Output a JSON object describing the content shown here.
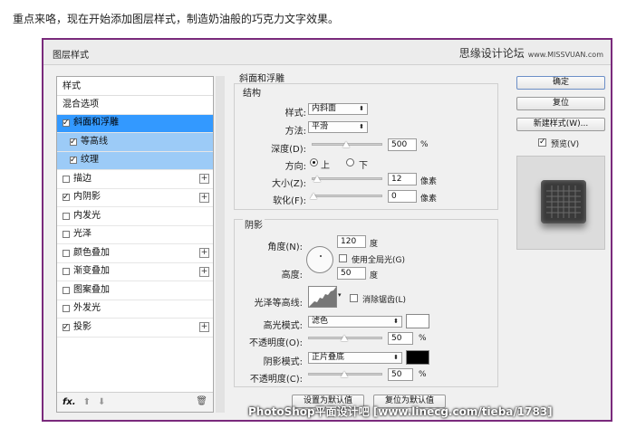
{
  "intro": "重点来咯，现在开始添加图层样式，制造奶油般的巧克力文字效果。",
  "dialog": {
    "title": "图层样式",
    "brand": "思缘设计论坛",
    "brand_url": "www.MISSVUAN.com"
  },
  "stylelist": {
    "header": "样式",
    "items": [
      {
        "label": "混合选项",
        "checkbox": false,
        "checked": false,
        "plus": false
      },
      {
        "label": "斜面和浮雕",
        "checkbox": true,
        "checked": true,
        "plus": false,
        "selected": true
      },
      {
        "label": "等高线",
        "checkbox": true,
        "checked": true,
        "plus": false,
        "sub": true
      },
      {
        "label": "纹理",
        "checkbox": true,
        "checked": true,
        "plus": false,
        "sub": true
      },
      {
        "label": "描边",
        "checkbox": true,
        "checked": false,
        "plus": true
      },
      {
        "label": "内阴影",
        "checkbox": true,
        "checked": true,
        "plus": true
      },
      {
        "label": "内发光",
        "checkbox": true,
        "checked": false,
        "plus": false
      },
      {
        "label": "光泽",
        "checkbox": true,
        "checked": false,
        "plus": false
      },
      {
        "label": "颜色叠加",
        "checkbox": true,
        "checked": false,
        "plus": true
      },
      {
        "label": "渐变叠加",
        "checkbox": true,
        "checked": false,
        "plus": true
      },
      {
        "label": "图案叠加",
        "checkbox": true,
        "checked": false,
        "plus": false
      },
      {
        "label": "外发光",
        "checkbox": true,
        "checked": false,
        "plus": false
      },
      {
        "label": "投影",
        "checkbox": true,
        "checked": true,
        "plus": true
      }
    ],
    "footer_fx": "fx."
  },
  "bevel": {
    "section_title": "斜面和浮雕",
    "structure_title": "结构",
    "style_label": "样式:",
    "style_value": "内斜面",
    "technique_label": "方法:",
    "technique_value": "平滑",
    "depth_label": "深度(D):",
    "depth_value": "500",
    "depth_unit": "%",
    "direction_label": "方向:",
    "direction_up": "上",
    "direction_down": "下",
    "size_label": "大小(Z):",
    "size_value": "12",
    "size_unit": "像素",
    "soften_label": "软化(F):",
    "soften_value": "0",
    "soften_unit": "像素"
  },
  "shading": {
    "title": "阴影",
    "angle_label": "角度(N):",
    "angle_value": "120",
    "angle_unit": "度",
    "global_light_label": "使用全局光(G)",
    "altitude_label": "高度:",
    "altitude_value": "50",
    "altitude_unit": "度",
    "gloss_label": "光泽等高线:",
    "antialias_label": "消除锯齿(L)",
    "highlight_label": "高光模式:",
    "highlight_value": "滤色",
    "highlight_color": "#ffffff",
    "hl_opacity_label": "不透明度(O):",
    "hl_opacity_value": "50",
    "hl_opacity_unit": "%",
    "shadow_label": "阴影模式:",
    "shadow_value": "正片叠底",
    "shadow_color": "#000000",
    "sh_opacity_label": "不透明度(C):",
    "sh_opacity_value": "50",
    "sh_opacity_unit": "%"
  },
  "buttons": {
    "ok": "确定",
    "reset": "复位",
    "new_style": "新建样式(W)...",
    "preview_label": "预览(V)",
    "make_default": "设置为默认值",
    "reset_default": "复位为默认值"
  },
  "watermark": "PhotoShop平面设计吧 [www.linecg.com/tieba/1783]"
}
